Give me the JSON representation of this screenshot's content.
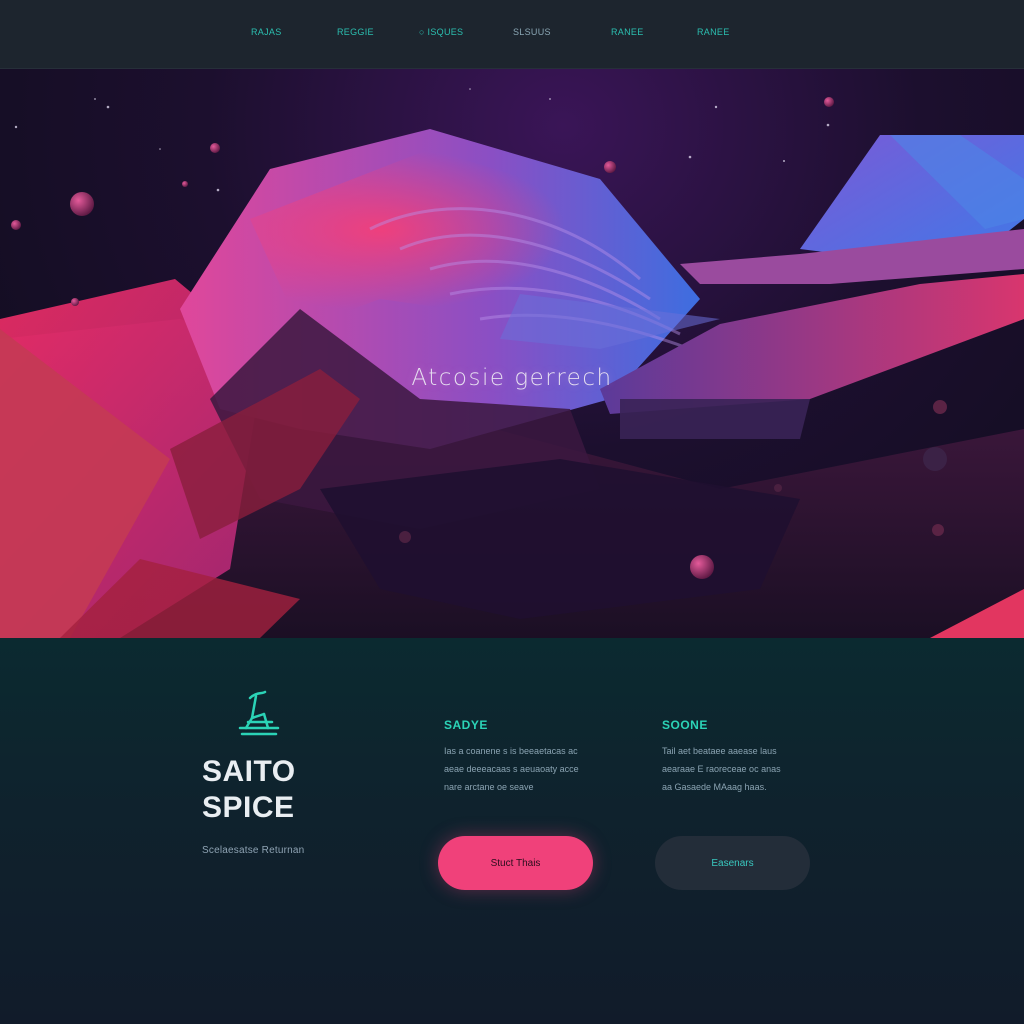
{
  "nav": {
    "items": [
      {
        "label": "RAJAS"
      },
      {
        "label": "REGGIE"
      },
      {
        "label": "○ ISQUES"
      },
      {
        "label": "SLSUUS"
      },
      {
        "label": "RANEE"
      },
      {
        "label": "RANEE"
      }
    ]
  },
  "hero": {
    "title": "Atcosie  gerrech"
  },
  "brand": {
    "logo_icon": "abstract-figure-icon",
    "title_line1": "SAITO",
    "title_line2": "SPICE",
    "tagline": "Scelaesatse Returnan"
  },
  "columns": [
    {
      "heading": "SADYE",
      "lines": [
        "Ias a coanene s is beeaetacas ac",
        "aeae deeeacaas s aeuaoaty acce",
        "nare arctane oe seave"
      ]
    },
    {
      "heading": "SOONE",
      "lines": [
        "Tail aet beataee aaease laus",
        "aearaae E raoreceae oc anas",
        "aa Gasaede MAaag haas."
      ]
    }
  ],
  "buttons": {
    "primary_label": "Stuct Thais",
    "secondary_label": "Easenars"
  },
  "colors": {
    "accent_teal": "#2bd3b6",
    "accent_pink": "#f0417a",
    "nav_bg": "#1d252e",
    "lower_bg": "#0f222d"
  }
}
